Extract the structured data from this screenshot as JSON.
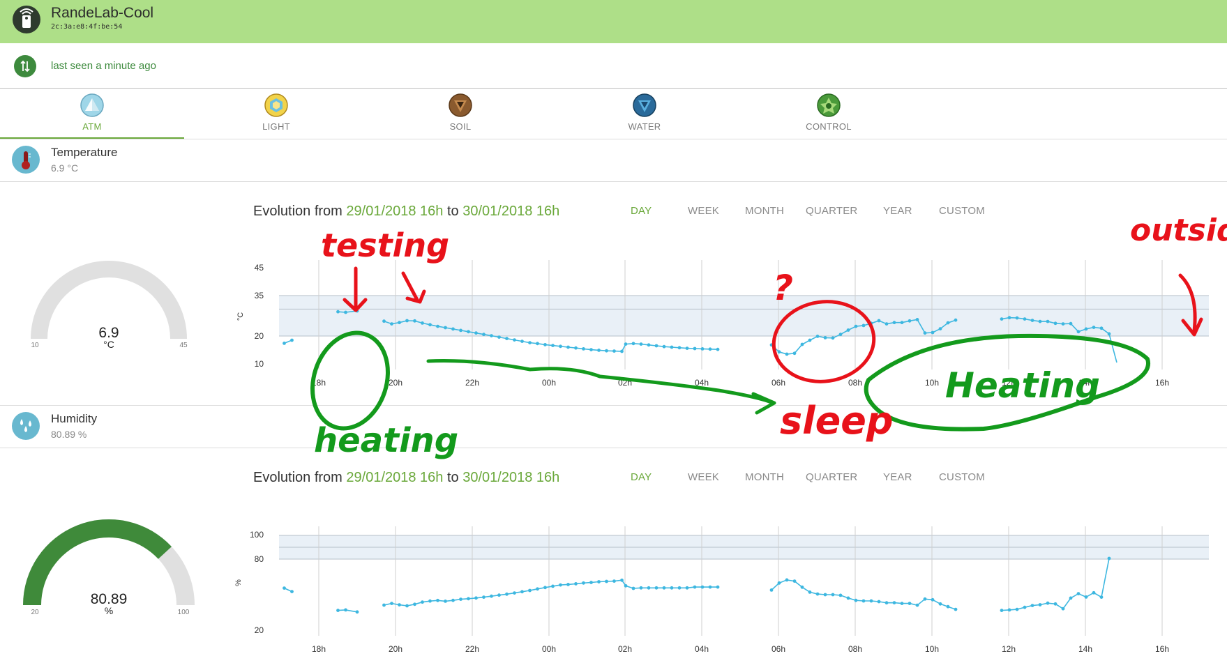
{
  "device": {
    "name": "RandeLab-Cool",
    "mac": "2c:3a:e8:4f:be:54",
    "last_seen": "last seen a minute ago"
  },
  "tabs": [
    {
      "label": "ATM",
      "icon": "atm-pyramid-icon",
      "color": "#9fd6e8",
      "active": true
    },
    {
      "label": "LIGHT",
      "icon": "light-sun-icon",
      "color": "#e8c73a",
      "active": false
    },
    {
      "label": "SOIL",
      "icon": "soil-icon",
      "color": "#8a5a2e",
      "active": false
    },
    {
      "label": "WATER",
      "icon": "water-drop-icon",
      "color": "#2a6a9a",
      "active": false
    },
    {
      "label": "CONTROL",
      "icon": "control-star-icon",
      "color": "#4a9a3a",
      "active": false
    }
  ],
  "range_options": [
    "DAY",
    "WEEK",
    "MONTH",
    "QUARTER",
    "YEAR",
    "CUSTOM"
  ],
  "sensors": [
    {
      "name": "Temperature",
      "value": "6.9 °C",
      "gauge": {
        "value": "6.9",
        "unit": "°C",
        "min": "10",
        "max": "45",
        "fill_fraction": 0
      },
      "evolution": {
        "prefix": "Evolution from",
        "from": "29/01/2018 16h",
        "to_word": "to",
        "to": "30/01/2018 16h"
      }
    },
    {
      "name": "Humidity",
      "value": "80.89 %",
      "gauge": {
        "value": "80.89",
        "unit": "%",
        "min": "20",
        "max": "100",
        "fill_fraction": 0.7611
      },
      "evolution": {
        "prefix": "Evolution from",
        "from": "29/01/2018 16h",
        "to_word": "to",
        "to": "30/01/2018 16h"
      }
    }
  ],
  "chart_data": [
    {
      "type": "line",
      "ylabel": "°C",
      "y_ticks": [
        "45",
        "35",
        "20",
        "10"
      ],
      "x_ticks": [
        "18h",
        "20h",
        "22h",
        "00h",
        "02h",
        "04h",
        "06h",
        "08h",
        "10h",
        "12h",
        "14h",
        "16h"
      ],
      "target_band": [
        20,
        35
      ],
      "band_line": 30,
      "series_color": "#3db7e0",
      "points": [
        [
          17.1,
          17.4
        ],
        [
          17.3,
          18.5
        ],
        [
          18.5,
          29
        ],
        [
          18.7,
          28.8
        ],
        [
          19.0,
          29.3
        ],
        [
          19.7,
          25.5
        ],
        [
          19.9,
          24.5
        ],
        [
          20.1,
          25
        ],
        [
          20.3,
          25.7
        ],
        [
          20.5,
          25.6
        ],
        [
          20.7,
          24.8
        ],
        [
          20.9,
          24.2
        ],
        [
          21.1,
          23.6
        ],
        [
          21.3,
          23.1
        ],
        [
          21.5,
          22.6
        ],
        [
          21.7,
          22.1
        ],
        [
          21.9,
          21.6
        ],
        [
          22.1,
          21.1
        ],
        [
          22.3,
          20.6
        ],
        [
          22.5,
          20.1
        ],
        [
          22.7,
          19.6
        ],
        [
          22.9,
          19.1
        ],
        [
          23.1,
          18.6
        ],
        [
          23.3,
          18.1
        ],
        [
          23.5,
          17.6
        ],
        [
          23.7,
          17.3
        ],
        [
          23.9,
          16.9
        ],
        [
          24.1,
          16.6
        ],
        [
          24.3,
          16.3
        ],
        [
          24.5,
          16
        ],
        [
          24.7,
          15.7
        ],
        [
          24.9,
          15.4
        ],
        [
          25.1,
          15.1
        ],
        [
          25.3,
          14.9
        ],
        [
          25.5,
          14.7
        ],
        [
          25.7,
          14.6
        ],
        [
          25.9,
          14.5
        ],
        [
          26.0,
          17.1
        ],
        [
          26.2,
          17.3
        ],
        [
          26.4,
          17.1
        ],
        [
          26.6,
          16.8
        ],
        [
          26.8,
          16.5
        ],
        [
          27.0,
          16.2
        ],
        [
          27.2,
          16
        ],
        [
          27.4,
          15.8
        ],
        [
          27.6,
          15.6
        ],
        [
          27.8,
          15.5
        ],
        [
          28.0,
          15.4
        ],
        [
          28.2,
          15.3
        ],
        [
          28.4,
          15.2
        ],
        [
          29.8,
          16.8
        ],
        [
          30.0,
          14.3
        ],
        [
          30.2,
          13.5
        ],
        [
          30.4,
          13.8
        ],
        [
          30.6,
          17
        ],
        [
          30.8,
          18.5
        ],
        [
          31.0,
          19.9
        ],
        [
          31.2,
          19.4
        ],
        [
          31.4,
          19.3
        ],
        [
          31.6,
          20.6
        ],
        [
          31.8,
          22.2
        ],
        [
          32.0,
          23.6
        ],
        [
          32.2,
          23.9
        ],
        [
          32.4,
          24.7
        ],
        [
          32.6,
          25.7
        ],
        [
          32.8,
          24.5
        ],
        [
          33.0,
          25
        ],
        [
          33.2,
          25
        ],
        [
          33.4,
          25.6
        ],
        [
          33.6,
          26.1
        ],
        [
          33.8,
          21.1
        ],
        [
          34.0,
          21.3
        ],
        [
          34.2,
          22.7
        ],
        [
          34.4,
          24.9
        ],
        [
          34.6,
          25.9
        ],
        [
          35.8,
          26.3
        ],
        [
          36.0,
          26.8
        ],
        [
          36.2,
          26.7
        ],
        [
          36.4,
          26.3
        ],
        [
          36.6,
          25.8
        ],
        [
          36.8,
          25.4
        ],
        [
          37.0,
          25.4
        ],
        [
          37.2,
          24.7
        ],
        [
          37.4,
          24.5
        ],
        [
          37.6,
          24.6
        ],
        [
          37.8,
          21.6
        ],
        [
          38.0,
          22.6
        ],
        [
          38.2,
          23.2
        ],
        [
          38.4,
          22.9
        ],
        [
          38.6,
          20.8
        ],
        [
          38.8,
          10.5
        ]
      ]
    },
    {
      "type": "line",
      "ylabel": "%",
      "y_ticks": [
        "100",
        "80",
        "20"
      ],
      "x_ticks": [
        "18h",
        "20h",
        "22h",
        "00h",
        "02h",
        "04h",
        "06h",
        "08h",
        "10h",
        "12h",
        "14h",
        "16h"
      ],
      "target_band": [
        80,
        100
      ],
      "band_line": 90,
      "series_color": "#3db7e0",
      "points": [
        [
          17.1,
          55.5
        ],
        [
          17.3,
          52.6
        ],
        [
          18.5,
          36.7
        ],
        [
          18.7,
          37.1
        ],
        [
          19.0,
          35.4
        ],
        [
          19.7,
          41.2
        ],
        [
          19.9,
          42.6
        ],
        [
          20.1,
          41.4
        ],
        [
          20.3,
          40.6
        ],
        [
          20.5,
          41.9
        ],
        [
          20.7,
          43.7
        ],
        [
          20.9,
          44.6
        ],
        [
          21.1,
          45.1
        ],
        [
          21.3,
          44.5
        ],
        [
          21.5,
          45.2
        ],
        [
          21.7,
          46.1
        ],
        [
          21.9,
          46.6
        ],
        [
          22.1,
          47.2
        ],
        [
          22.3,
          47.9
        ],
        [
          22.5,
          48.7
        ],
        [
          22.7,
          49.6
        ],
        [
          22.9,
          50.4
        ],
        [
          23.1,
          51.4
        ],
        [
          23.3,
          52.5
        ],
        [
          23.5,
          53.5
        ],
        [
          23.7,
          54.8
        ],
        [
          23.9,
          56
        ],
        [
          24.1,
          57.1
        ],
        [
          24.3,
          58.2
        ],
        [
          24.5,
          58.6
        ],
        [
          24.7,
          59.2
        ],
        [
          24.9,
          59.8
        ],
        [
          25.1,
          60.3
        ],
        [
          25.3,
          60.9
        ],
        [
          25.5,
          61.2
        ],
        [
          25.7,
          61.4
        ],
        [
          25.9,
          62.2
        ],
        [
          26.0,
          57.5
        ],
        [
          26.2,
          55.3
        ],
        [
          26.4,
          55.7
        ],
        [
          26.6,
          55.7
        ],
        [
          26.8,
          55.7
        ],
        [
          27.0,
          55.7
        ],
        [
          27.2,
          55.7
        ],
        [
          27.4,
          55.7
        ],
        [
          27.6,
          55.7
        ],
        [
          27.8,
          56.4
        ],
        [
          28.0,
          56.4
        ],
        [
          28.2,
          56.4
        ],
        [
          28.4,
          56.4
        ],
        [
          29.8,
          53.9
        ],
        [
          30.0,
          59.8
        ],
        [
          30.2,
          62.4
        ],
        [
          30.4,
          61.4
        ],
        [
          30.6,
          56.3
        ],
        [
          30.8,
          52.1
        ],
        [
          31.0,
          50.5
        ],
        [
          31.2,
          50
        ],
        [
          31.4,
          50
        ],
        [
          31.6,
          49.5
        ],
        [
          31.8,
          47.1
        ],
        [
          32.0,
          45.2
        ],
        [
          32.2,
          44.7
        ],
        [
          32.4,
          44.7
        ],
        [
          32.6,
          44.1
        ],
        [
          32.8,
          43.1
        ],
        [
          33.0,
          43.2
        ],
        [
          33.2,
          42.6
        ],
        [
          33.4,
          42.6
        ],
        [
          33.6,
          41.1
        ],
        [
          33.8,
          46.3
        ],
        [
          34.0,
          45.7
        ],
        [
          34.2,
          42.2
        ],
        [
          34.4,
          39.9
        ],
        [
          34.6,
          37.6
        ],
        [
          35.8,
          36.7
        ],
        [
          36.0,
          37.1
        ],
        [
          36.2,
          37.6
        ],
        [
          36.4,
          39.3
        ],
        [
          36.6,
          40.8
        ],
        [
          36.8,
          41.5
        ],
        [
          37.0,
          42.8
        ],
        [
          37.2,
          42.2
        ],
        [
          37.4,
          38.1
        ],
        [
          37.6,
          47.1
        ],
        [
          37.8,
          50.8
        ],
        [
          38.0,
          48
        ],
        [
          38.2,
          51.6
        ],
        [
          38.4,
          47.9
        ],
        [
          38.6,
          80.6
        ]
      ]
    }
  ],
  "annotations": {
    "testing": "testing",
    "question": "?",
    "outside": "outsid",
    "heating_left": "heating",
    "sleep": "sleep",
    "heating_right": "Heating"
  }
}
